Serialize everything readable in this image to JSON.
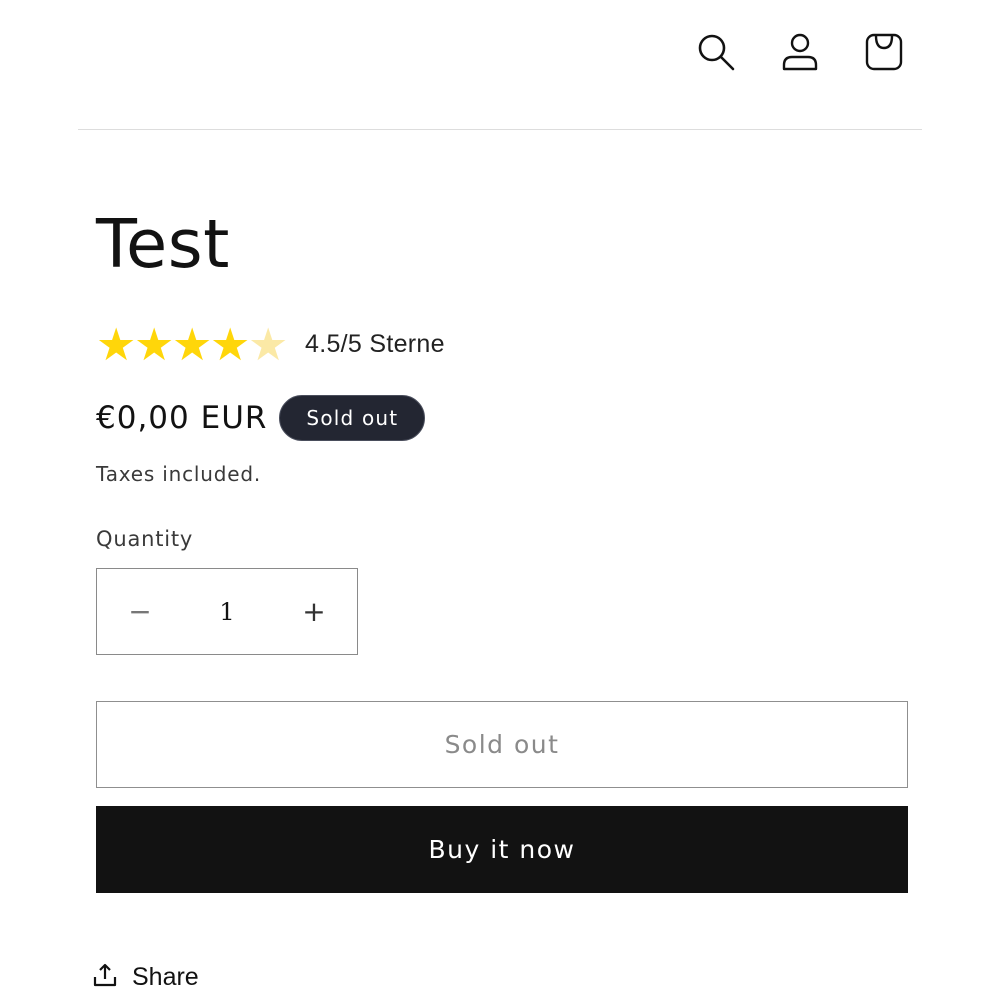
{
  "header": {
    "icons": [
      "search-icon",
      "account-icon",
      "cart-icon"
    ]
  },
  "product": {
    "title": "Test",
    "rating": {
      "value": 4.5,
      "max": 5,
      "text": "4.5/5 Sterne",
      "star_color": "#FFD60A",
      "half_star_color": "#FBE9A6"
    },
    "price": "€0,00 EUR",
    "badge": "Sold out",
    "tax_note": "Taxes included.",
    "quantity": {
      "label": "Quantity",
      "value": "1",
      "minus_symbol": "−",
      "plus_symbol": "+"
    },
    "sold_out_button": "Sold out",
    "buy_button": "Buy it now",
    "share_label": "Share"
  }
}
